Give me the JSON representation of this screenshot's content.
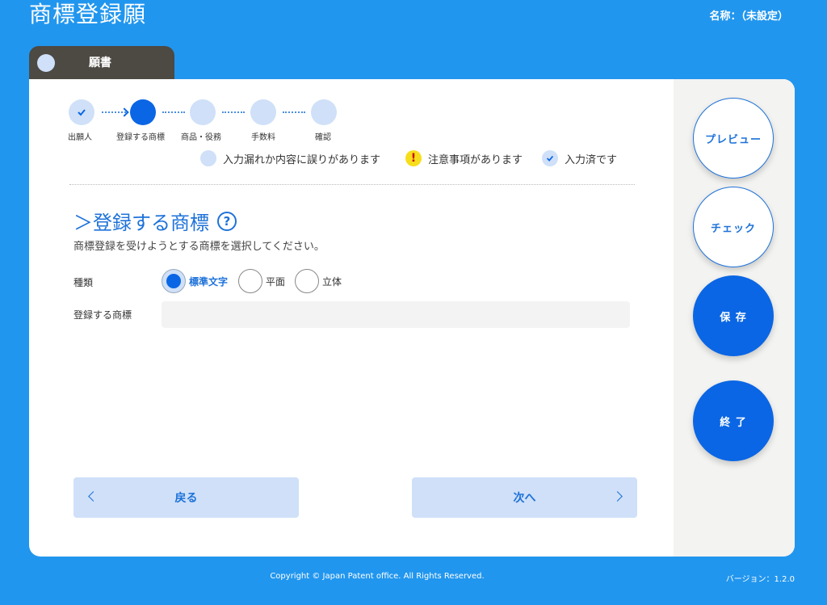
{
  "header": {
    "title": "商標登録願",
    "name_label": "名称：（未設定）"
  },
  "tab": {
    "label": "願書"
  },
  "stepper": {
    "steps": [
      {
        "label": "出願人",
        "state": "done"
      },
      {
        "label": "登録する商標",
        "state": "active"
      },
      {
        "label": "商品・役務",
        "state": "pending"
      },
      {
        "label": "手数料",
        "state": "pending"
      },
      {
        "label": "確認",
        "state": "pending"
      }
    ]
  },
  "legend": {
    "error": "入力漏れか内容に誤りがあります",
    "warning": "注意事項があります",
    "done": "入力済です",
    "warning_symbol": "!"
  },
  "section": {
    "title": "＞登録する商標",
    "help_symbol": "?",
    "description": "商標登録を受けようとする商標を選択してください。"
  },
  "form": {
    "type_label": "種類",
    "type_options": [
      {
        "label": "標準文字",
        "checked": true
      },
      {
        "label": "平面",
        "checked": false
      },
      {
        "label": "立体",
        "checked": false
      }
    ],
    "mark_label": "登録する商標",
    "mark_value": ""
  },
  "nav": {
    "back": "戻る",
    "next": "次へ"
  },
  "actions": {
    "preview": "プレビュー",
    "check": "チェック",
    "save": "保 存",
    "exit": "終 了"
  },
  "footer": {
    "copyright": "Copyright © Japan Patent office. All Rights Reserved.",
    "version": "バージョン：1.2.0"
  },
  "colors": {
    "background": "#2196ee",
    "accent": "#0a66e4",
    "light_accent": "#cfe0f8",
    "warning": "#f7de1c"
  }
}
